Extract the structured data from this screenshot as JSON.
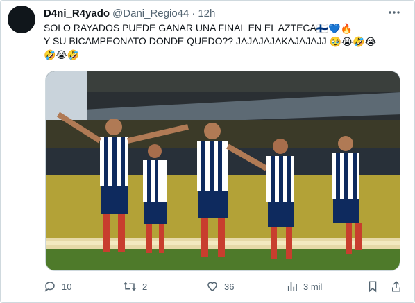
{
  "tweet": {
    "display_name": "D4ni_R4yado",
    "handle": "@Dani_Regio44",
    "separator": "·",
    "time": "12h",
    "more_icon": "more-horizontal-icon",
    "text_line1": "SOLO RAYADOS PUEDE GANAR UNA FINAL EN EL AZTECA",
    "text_line1_emojis": "🇫🇮💙🔥",
    "text_line2": "Y SU BICAMPEONATO DONDE QUEDO?? JAJAJAJAKAJAJAJJ",
    "text_line2_emojis": "🥹😭🤣😭",
    "text_line3_emojis": "🤣😭🤣"
  },
  "actions": {
    "replies": "10",
    "retweets": "2",
    "likes": "36",
    "views": "3 mil"
  },
  "colors": {
    "text": "#0f1419",
    "muted": "#536471",
    "border": "#cfd9de"
  }
}
